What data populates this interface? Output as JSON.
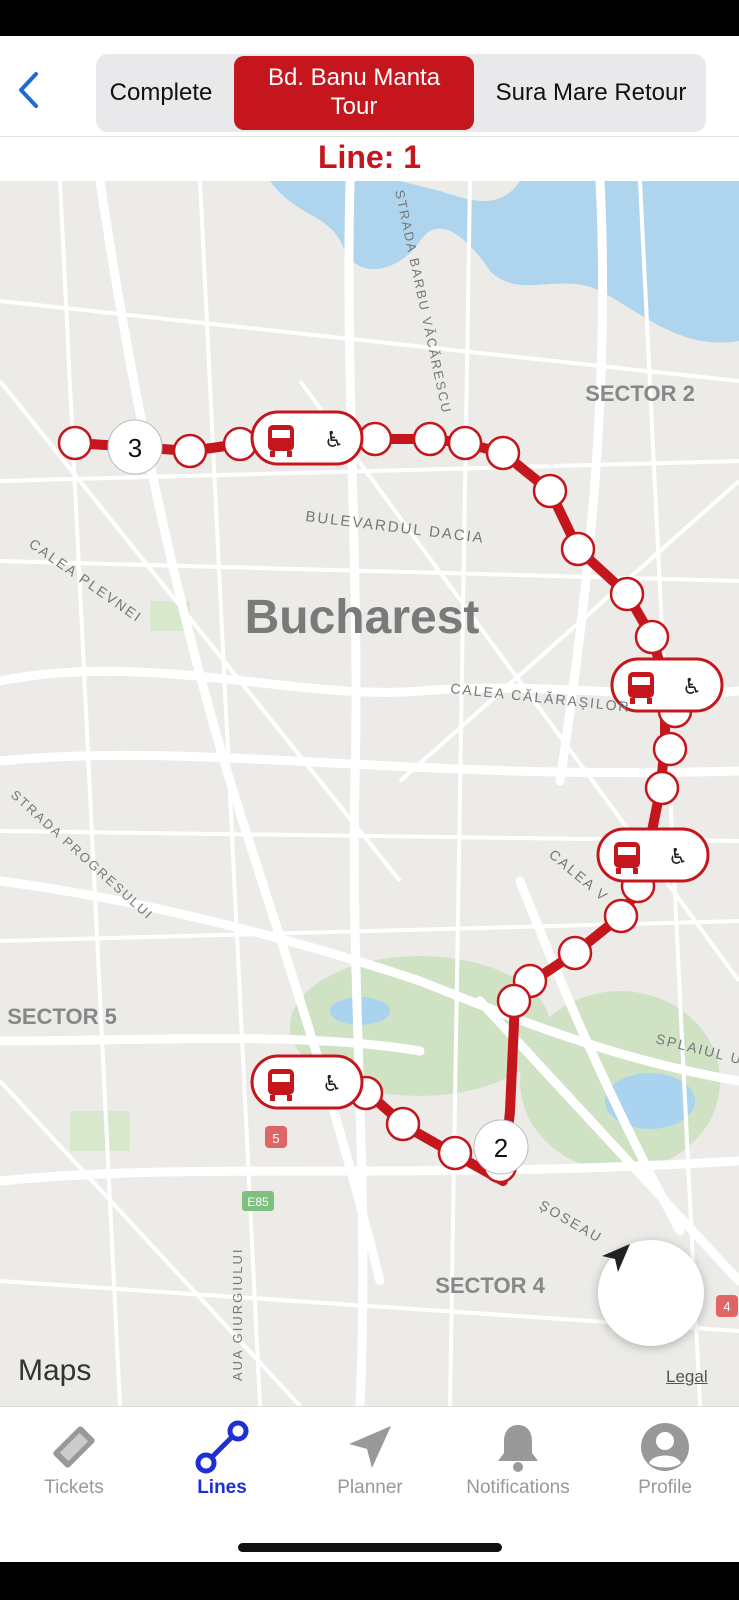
{
  "header": {
    "segments": [
      {
        "label": "Complete",
        "active": false
      },
      {
        "label": "Bd. Banu Manta Tour",
        "active": true
      },
      {
        "label": "Sura Mare Retour",
        "active": false
      }
    ],
    "line_title": "Line: 1"
  },
  "map": {
    "labels": {
      "city": "Bucharest",
      "sector2": "SECTOR 2",
      "sector5": "SECTOR 5",
      "sector4": "SECTOR 4",
      "bulevardul_dacia": "BULEVARDUL DACIA",
      "calea_plevnei": "CALEA PLEVNEI",
      "calea_calarasilor": "CALEA CĂLĂRAȘILOR",
      "strada_progresului": "STRADA PROGRESULUI",
      "strada_barbu": "STRADA BARBU VĂCĂRESCU",
      "splaiul": "SPLAIUL U",
      "calea_v": "CALEA V",
      "soseaua": "ȘOSEAU",
      "giurgiului": "AUA GIURGIULUI",
      "shield_5": "5",
      "shield_e85": "E85",
      "shield_4": "4"
    },
    "cluster_labels": [
      "3",
      "2"
    ],
    "accent_color": "#c4161c",
    "attribution": "Maps",
    "legal": "Legal"
  },
  "tabs": [
    {
      "label": "Tickets",
      "icon": "ticket-icon",
      "active": false
    },
    {
      "label": "Lines",
      "icon": "lines-icon",
      "active": true
    },
    {
      "label": "Planner",
      "icon": "navigation-arrow-icon",
      "active": false
    },
    {
      "label": "Notifications",
      "icon": "bell-icon",
      "active": false
    },
    {
      "label": "Profile",
      "icon": "person-icon",
      "active": false
    }
  ]
}
